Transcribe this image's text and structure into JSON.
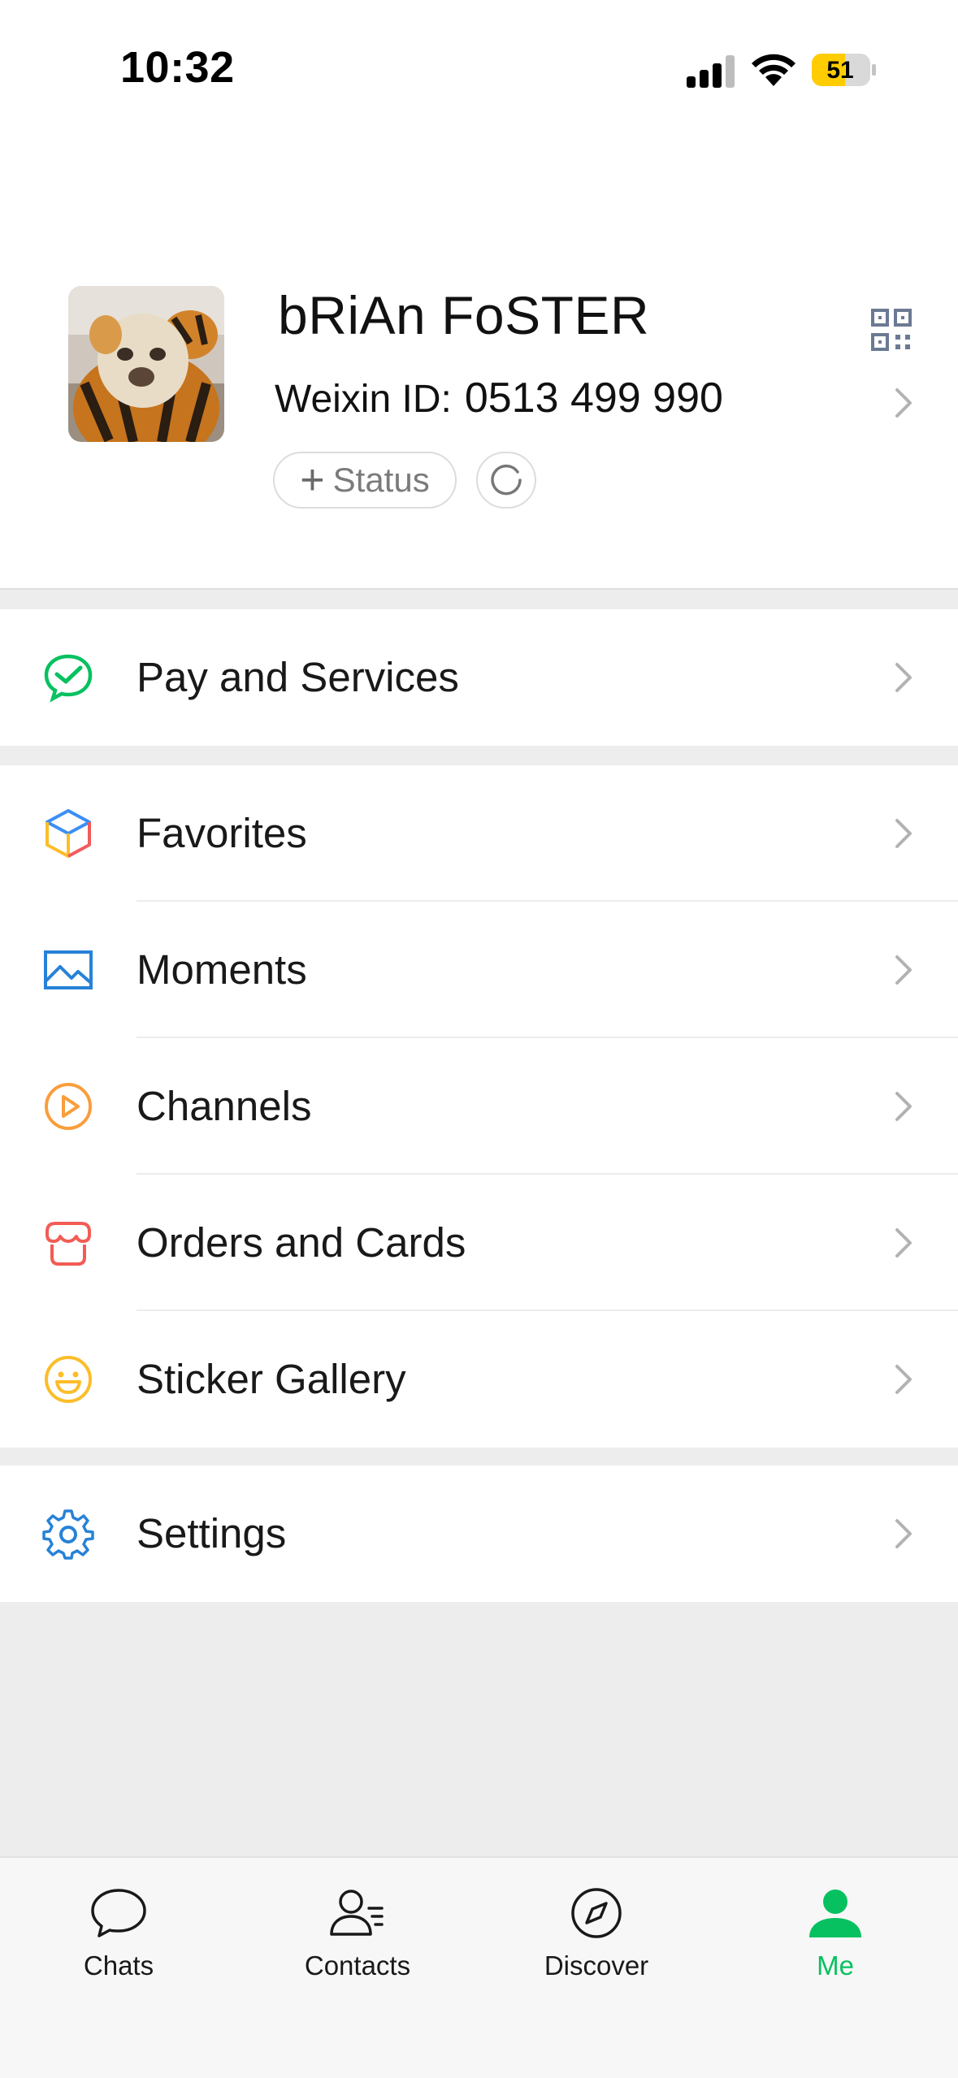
{
  "status_bar": {
    "time": "10:32",
    "battery": "51"
  },
  "profile": {
    "name": "bRiAn FoSTER",
    "id_label": "Weixin ID:",
    "id_value": "0513 499 990",
    "status_label": "Status"
  },
  "menu": {
    "pay": "Pay and Services",
    "favorites": "Favorites",
    "moments": "Moments",
    "channels": "Channels",
    "orders": "Orders and Cards",
    "stickers": "Sticker Gallery",
    "settings": "Settings"
  },
  "tabs": {
    "chats": "Chats",
    "contacts": "Contacts",
    "discover": "Discover",
    "me": "Me"
  },
  "colors": {
    "accent": "#07c160",
    "battery": "#ffcc00"
  }
}
